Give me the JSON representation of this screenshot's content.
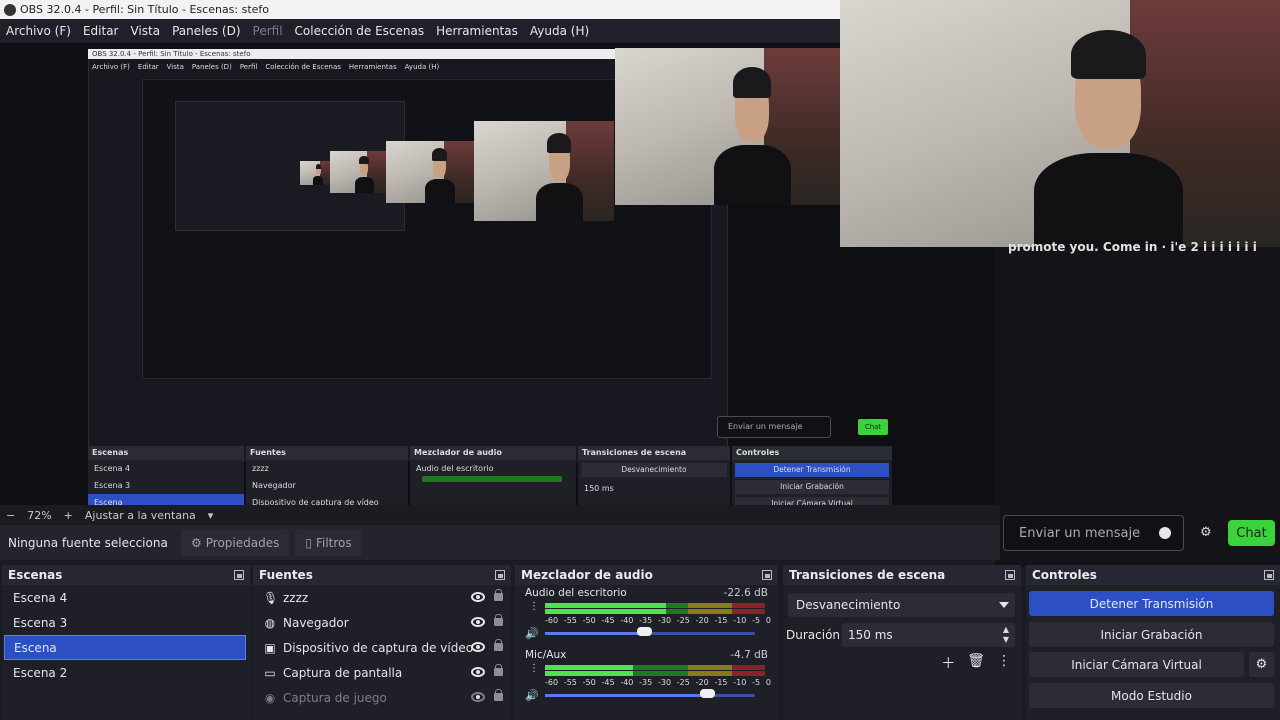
{
  "window": {
    "title": "OBS 32.0.4 - Perfil: Sin Título - Escenas: stefo"
  },
  "menu": [
    {
      "label": "Archivo (F)",
      "disabled": false
    },
    {
      "label": "Editar",
      "disabled": false
    },
    {
      "label": "Vista",
      "disabled": false
    },
    {
      "label": "Paneles (D)",
      "disabled": false
    },
    {
      "label": "Perfil",
      "disabled": true
    },
    {
      "label": "Colección de Escenas",
      "disabled": false
    },
    {
      "label": "Herramientas",
      "disabled": false
    },
    {
      "label": "Ayuda (H)",
      "disabled": false
    }
  ],
  "chat": {
    "overlay_text": "promote you. Come in  · i'e 2 i i i i i i i",
    "placeholder": "Enviar un mensaje",
    "send_label": "Chat",
    "accent": "#3bd33b"
  },
  "preview_toolbar": {
    "zoom_out": "−",
    "zoom": "72%",
    "zoom_in": "+",
    "fit": "Ajustar a la ventana",
    "fit_arrow": "▾"
  },
  "source_toolbar": {
    "none_selected": "Ninguna fuente selecciona",
    "properties": "Propiedades",
    "filters": "Filtros"
  },
  "scenes": {
    "title": "Escenas",
    "items": [
      "Escena 4",
      "Escena 3",
      "Escena",
      "Escena 2"
    ],
    "selected_index": 2
  },
  "sources": {
    "title": "Fuentes",
    "items": [
      {
        "label": "zzzz",
        "icon": "microphone-icon",
        "glyph": "🎙",
        "dim": false
      },
      {
        "label": "Navegador",
        "icon": "globe-icon",
        "glyph": "◍",
        "dim": false
      },
      {
        "label": "Dispositivo de captura de vídeo",
        "icon": "camera-icon",
        "glyph": "▣",
        "dim": false
      },
      {
        "label": "Captura de pantalla",
        "icon": "monitor-icon",
        "glyph": "▭",
        "dim": false
      },
      {
        "label": "Captura de juego",
        "icon": "gamepad-icon",
        "glyph": "◉",
        "dim": true
      }
    ]
  },
  "mixer": {
    "title": "Mezclador de audio",
    "scale": [
      "-60",
      "-55",
      "-50",
      "-45",
      "-40",
      "-35",
      "-30",
      "-25",
      "-20",
      "-15",
      "-10",
      "-5",
      "0"
    ],
    "channels": [
      {
        "name": "Audio del escritorio",
        "db": "-22.6 dB",
        "level_fraction": 0.55,
        "volume_fraction": 0.47
      },
      {
        "name": "Mic/Aux",
        "db": "-4.7 dB",
        "level_fraction": 0.4,
        "volume_fraction": 0.77
      }
    ],
    "colors": {
      "green": "#4fe34f",
      "yellow": "#8a7a1a",
      "red": "#8a2424",
      "slider": "#5a7af0"
    }
  },
  "transitions": {
    "title": "Transiciones de escena",
    "selected": "Desvanecimiento",
    "duration_label": "Duración",
    "duration_value": "150 ms"
  },
  "controls": {
    "title": "Controles",
    "stop_stream": "Detener Transmisión",
    "start_recording": "Iniciar Grabación",
    "virtual_camera": "Iniciar Cámara Virtual",
    "studio_mode": "Modo Estudio",
    "accent": "#2c4fc4"
  }
}
